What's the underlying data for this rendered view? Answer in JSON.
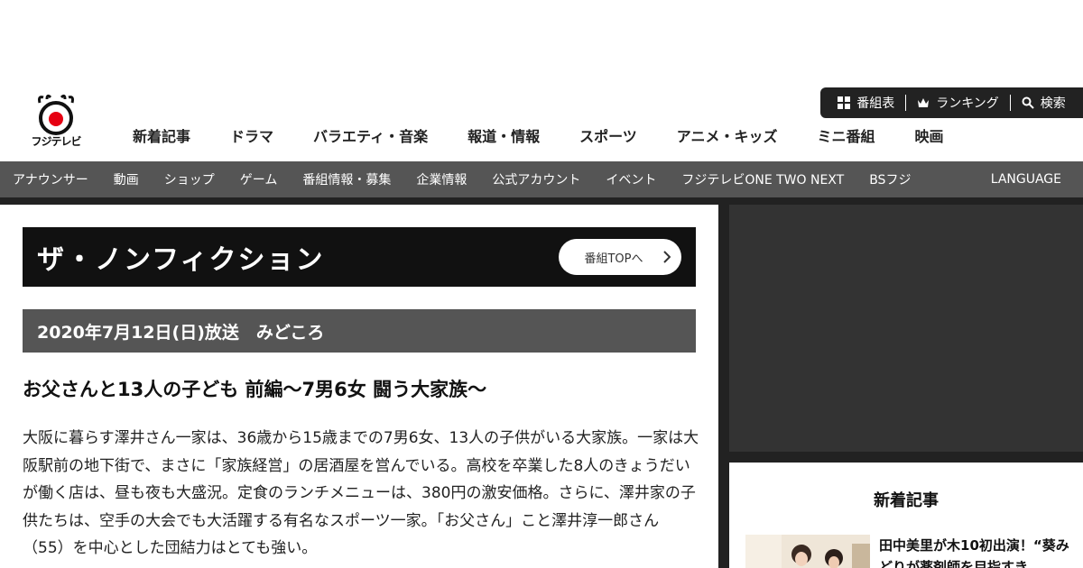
{
  "logo": {
    "text": "フジテレビ"
  },
  "utility": [
    {
      "icon": "grid-icon",
      "label": "番組表"
    },
    {
      "icon": "crown-icon",
      "label": "ランキング"
    },
    {
      "icon": "search-icon",
      "label": "検索"
    }
  ],
  "main_nav": [
    "新着記事",
    "ドラマ",
    "バラエティ・音楽",
    "報道・情報",
    "スポーツ",
    "アニメ・キッズ",
    "ミニ番組",
    "映画"
  ],
  "sub_nav": [
    "アナウンサー",
    "動画",
    "ショップ",
    "ゲーム",
    "番組情報・募集",
    "企業情報",
    "公式アカウント",
    "イベント",
    "フジテレビONE TWO NEXT",
    "BSフジ"
  ],
  "language": "LANGUAGE",
  "program": {
    "title": "ザ・ノンフィクション",
    "top_button": "番組TOPへ",
    "date_heading": "2020年7月12日(日)放送　みどころ",
    "episode_title": "お父さんと13人の子ども 前編～7男6女 闘う大家族～",
    "body": "大阪に暮らす澤井さん一家は、36歳から15歳までの7男6女、13人の子供がいる大家族。一家は大阪駅前の地下街で、まさに「家族経営」の居酒屋を営んでいる。高校を卒業した8人のきょうだいが働く店は、昼も夜も大盛況。定食のランチメニューは、380円の激安価格。さらに、澤井家の子供たちは、空手の大会でも大活躍する有名なスポーツ一家。「お父さん」こと澤井淳一郎さん（55）を中心とした団結力はとても強い。"
  },
  "sidebar": {
    "news_heading": "新着記事",
    "news_item_title": "田中美里が木10初出演！“葵みどりが薬剤師を目指すき"
  },
  "colors": {
    "dark": "#222222",
    "title_bg": "#111111",
    "subnav_bg": "#555555",
    "logo_red": "#e60012"
  }
}
